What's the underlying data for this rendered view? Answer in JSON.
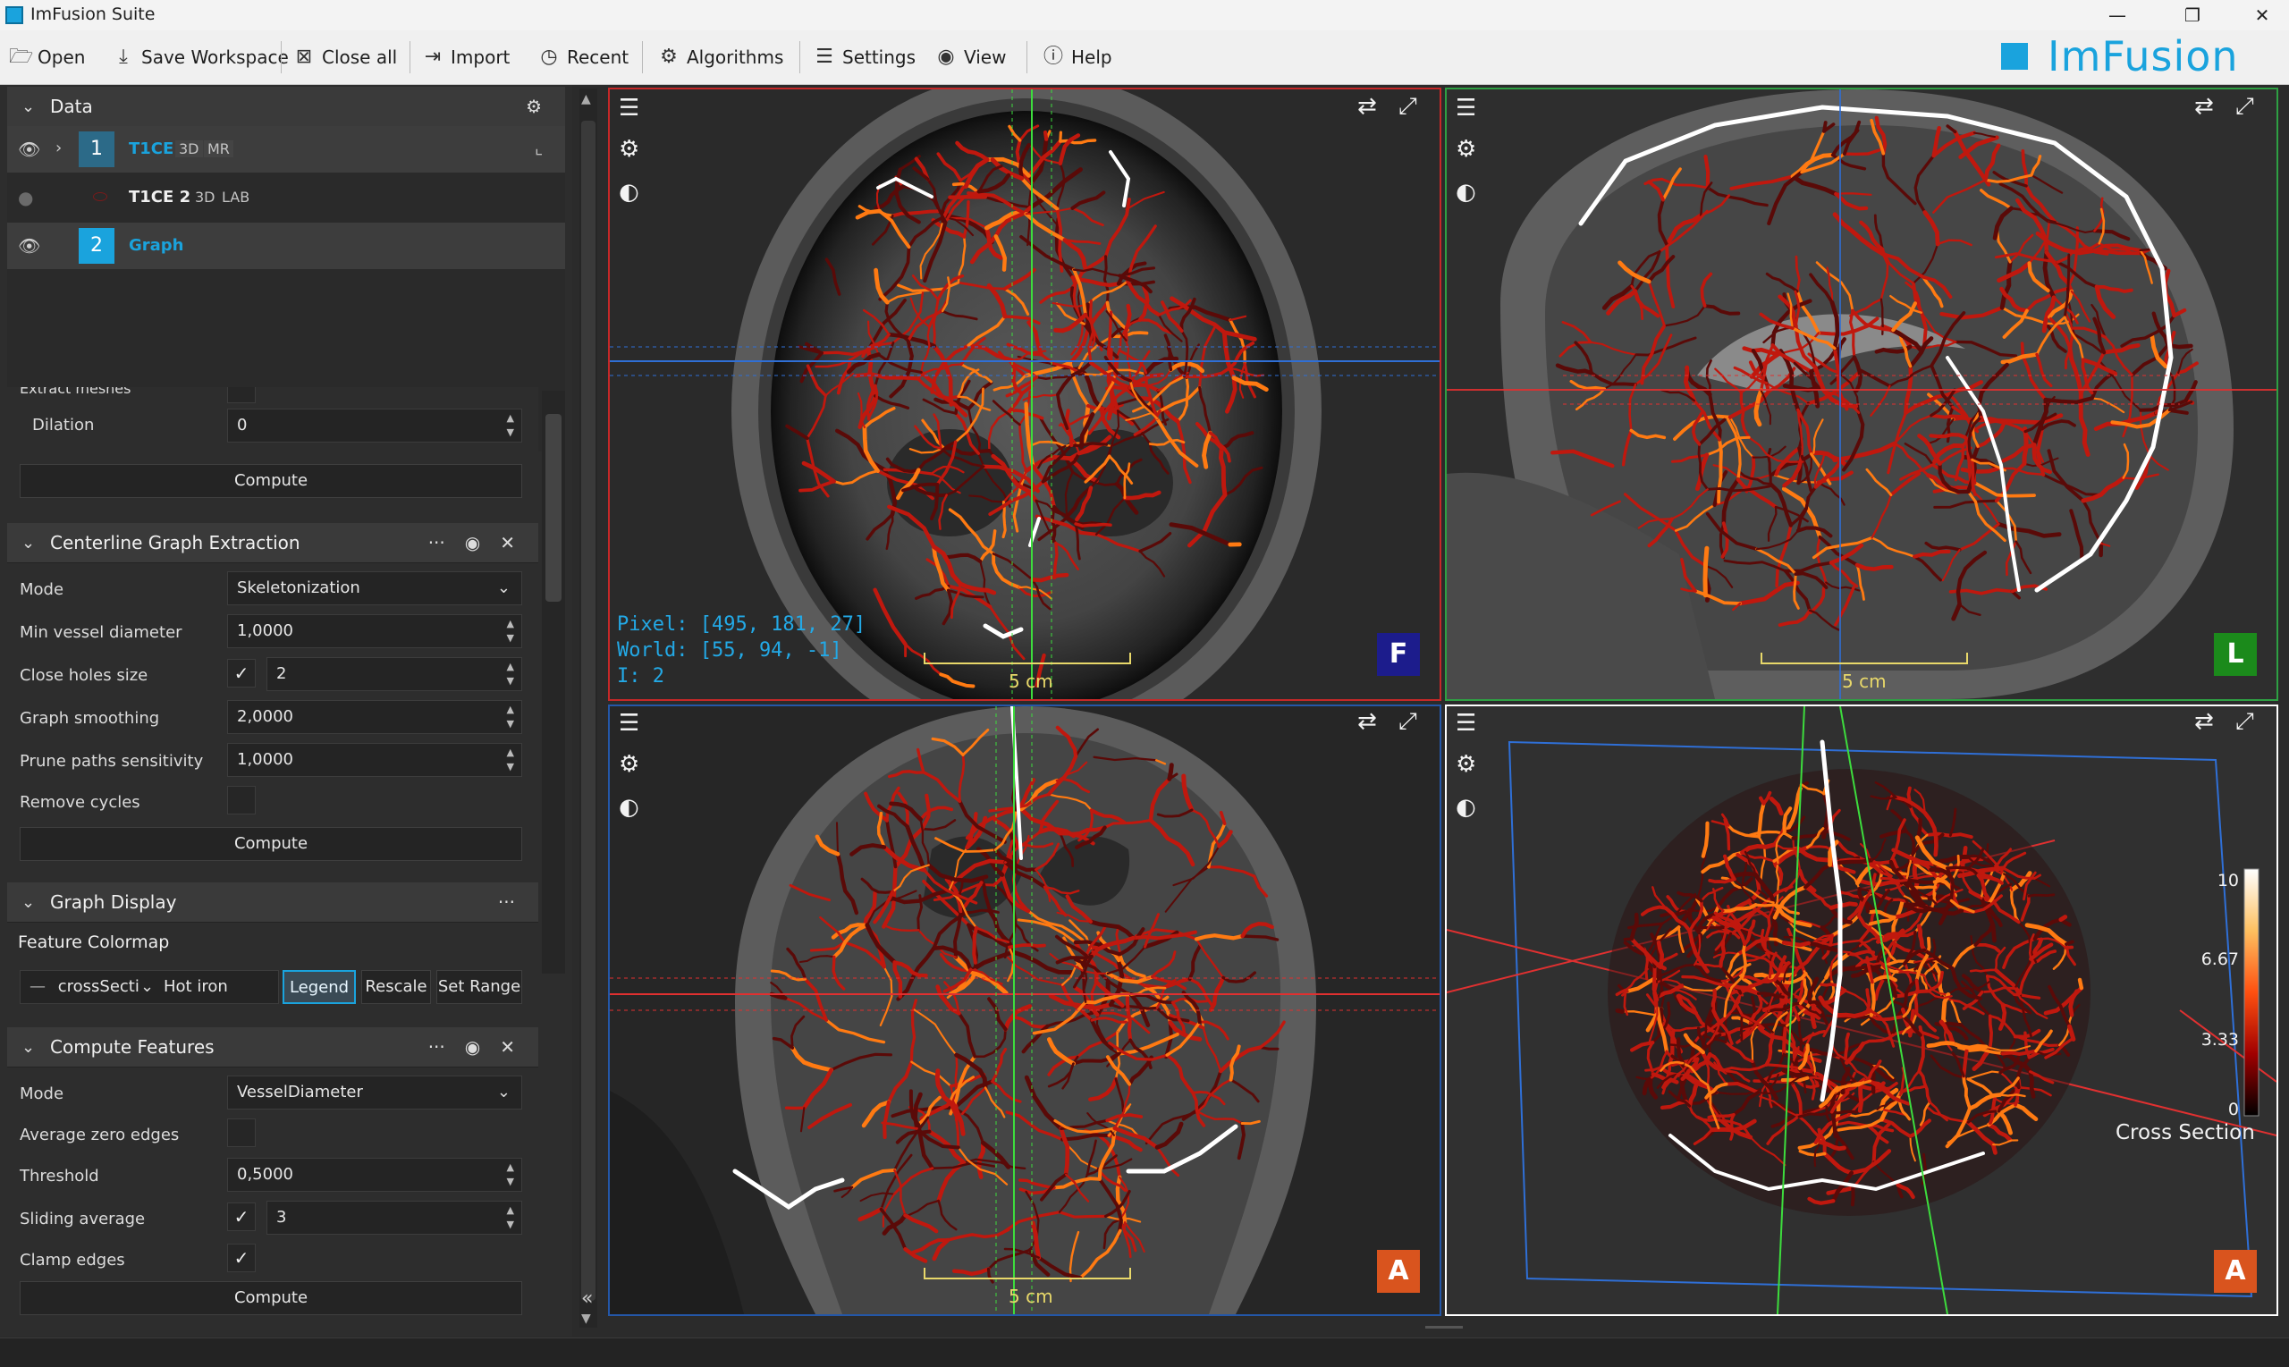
{
  "window": {
    "title": "ImFusion Suite",
    "controls": [
      "—",
      "❐",
      "✕"
    ]
  },
  "menu": {
    "open": "Open",
    "save_workspace": "Save Workspace",
    "close_all": "Close all",
    "import": "Import",
    "recent": "Recent",
    "algorithms": "Algorithms",
    "settings": "Settings",
    "view": "View",
    "help": "Help"
  },
  "logo": {
    "text": "ImFusion"
  },
  "data_panel": {
    "title": "Data",
    "items": [
      {
        "index": "1",
        "name": "T1CE",
        "tags": [
          "3D",
          "MR"
        ]
      },
      {
        "index": "",
        "name": "T1CE 2",
        "tags": [
          "3D",
          "LAB"
        ]
      },
      {
        "index": "2",
        "name": "Graph",
        "tags": []
      }
    ]
  },
  "extract_section": {
    "clipped_label": "Extract meshes",
    "dilation_label": "Dilation",
    "dilation_value": "0",
    "compute_label": "Compute"
  },
  "centerline": {
    "title": "Centerline Graph Extraction",
    "menu_glyph": "···",
    "mode_label": "Mode",
    "mode_value": "Skeletonization",
    "min_vessel_label": "Min vessel diameter",
    "min_vessel_value": "1,0000",
    "close_holes_label": "Close holes size",
    "close_holes_value": "2",
    "smoothing_label": "Graph smoothing",
    "smoothing_value": "2,0000",
    "prune_label": "Prune paths sensitivity",
    "prune_value": "1,0000",
    "remove_cycles_label": "Remove cycles",
    "compute_label": "Compute"
  },
  "graph_display": {
    "title": "Graph Display",
    "menu_glyph": "···",
    "feature_colormap_label": "Feature Colormap",
    "feature_value": "crossSecti",
    "colormap_value": "Hot iron",
    "legend_label": "Legend",
    "rescale_label": "Rescale",
    "set_range_label": "Set Range"
  },
  "compute_features": {
    "title": "Compute Features",
    "menu_glyph": "···",
    "mode_label": "Mode",
    "mode_value": "VesselDiameter",
    "avg_zero_label": "Average zero edges",
    "threshold_label": "Threshold",
    "threshold_value": "0,5000",
    "sliding_label": "Sliding average",
    "sliding_value": "3",
    "clamp_label": "Clamp edges",
    "compute_label": "Compute"
  },
  "viewports": {
    "axial": {
      "info_pixel": "Pixel: [495, 181, 27]",
      "info_world": "World: [55, 94, -1]",
      "info_i": "I: 2",
      "scale": "5 cm",
      "orient": "F",
      "orient_color": "#1c1c8c",
      "border_color": "#c62828"
    },
    "sagittal": {
      "scale": "5 cm",
      "orient": "L",
      "orient_color": "#1b8a1b",
      "border_color": "#2ea043"
    },
    "coronal": {
      "scale": "5 cm",
      "orient": "A",
      "orient_color": "#d9541e",
      "border_color": "#2457a8"
    },
    "render3d": {
      "orient": "A",
      "orient_color": "#d9541e",
      "border_color": "#ffffff",
      "legend_ticks": [
        "10",
        "6.67",
        "3.33",
        "0"
      ],
      "legend_title": "Cross Section"
    }
  },
  "colors": {
    "accent": "#1aa3dd",
    "vessel_dark": "#5a0a08",
    "vessel_red": "#c0180e",
    "vessel_orange": "#ff7a12",
    "vessel_white": "#ffffff",
    "crosshair_green": "#3ddc3d",
    "crosshair_blue": "#2f6fd6",
    "crosshair_red": "#e03030",
    "scale_yellow": "#e8d86a"
  },
  "icons": {
    "viewport_menu": "hamburger-icon",
    "viewport_settings": "gear-icon",
    "viewport_brightness": "brightness-icon",
    "viewport_swap": "swap-icon",
    "viewport_maximize": "maximize-icon"
  }
}
